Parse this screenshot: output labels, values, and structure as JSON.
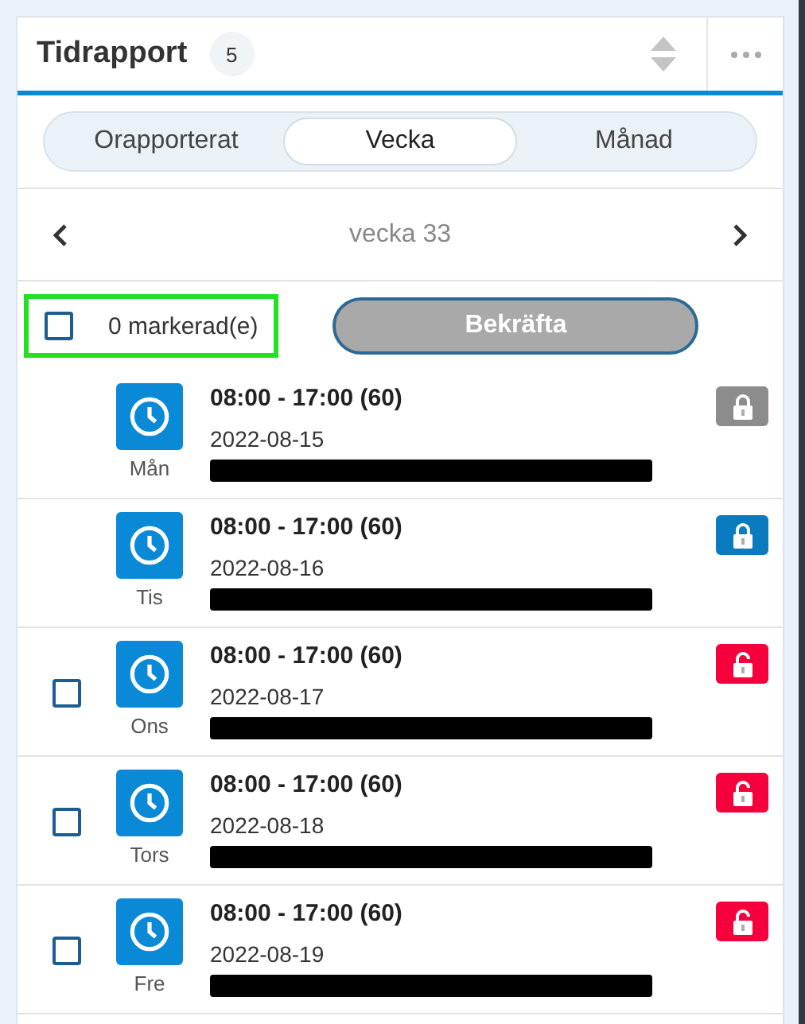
{
  "header": {
    "title": "Tidrapport",
    "count": "5"
  },
  "tabs": [
    {
      "label": "Orapporterat",
      "selected": false
    },
    {
      "label": "Vecka",
      "selected": true
    },
    {
      "label": "Månad",
      "selected": false
    }
  ],
  "nav": {
    "label": "vecka 33"
  },
  "selection": {
    "checked": false,
    "highlighted": true,
    "label": "0 markerad(e)",
    "button": "Bekräfta",
    "button_disabled": true
  },
  "rows": [
    {
      "time": "08:00 - 17:00 (60)",
      "date": "2022-08-15",
      "day": "Mån",
      "selectable": false,
      "locked": true,
      "color": "#8c8c8c"
    },
    {
      "time": "08:00 - 17:00 (60)",
      "date": "2022-08-16",
      "day": "Tis",
      "selectable": false,
      "locked": true,
      "color": "#0a7bbf"
    },
    {
      "time": "08:00 - 17:00 (60)",
      "date": "2022-08-17",
      "day": "Ons",
      "selectable": true,
      "checked": false,
      "locked": false,
      "color": "#f5003d"
    },
    {
      "time": "08:00 - 17:00 (60)",
      "date": "2022-08-18",
      "day": "Tors",
      "selectable": true,
      "checked": false,
      "locked": false,
      "color": "#f5003d"
    },
    {
      "time": "08:00 - 17:00 (60)",
      "date": "2022-08-19",
      "day": "Fre",
      "selectable": true,
      "checked": false,
      "locked": false,
      "color": "#f5003d"
    }
  ]
}
